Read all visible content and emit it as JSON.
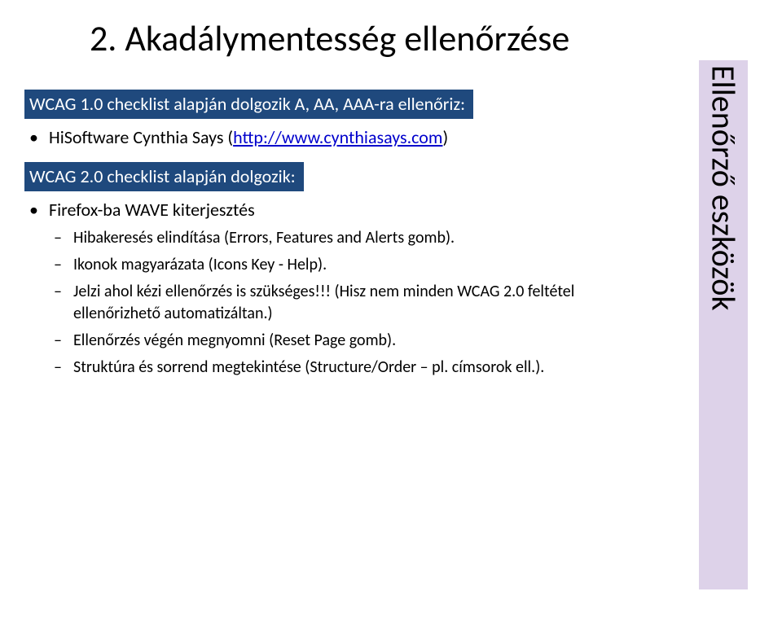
{
  "title": "2. Akadálymentesség ellenőrzése",
  "section1": {
    "label": "WCAG 1.0 checklist alapján dolgozik A, AA, AAA-ra ellenőriz:",
    "item_prefix": "HiSoftware Cynthia Says (",
    "link_text": "http://www.cynthiasays.com",
    "item_suffix": ")"
  },
  "section2": {
    "label": "WCAG 2.0 checklist alapján dolgozik:",
    "item": "Firefox-ba WAVE kiterjesztés",
    "sub": [
      "Hibakeresés elindítása (Errors, Features and Alerts gomb).",
      "Ikonok magyarázata (Icons Key - Help).",
      "Jelzi ahol kézi ellenőrzés is szükséges!!! (Hisz nem minden WCAG 2.0 feltétel ellenőrizhető automatizáltan.)",
      "Ellenőrzés végén megnyomni (Reset Page gomb).",
      "Struktúra és sorrend megtekintése (Structure/Order – pl. címsorok ell.)."
    ]
  },
  "sidebar": "Ellenőrző eszközök"
}
